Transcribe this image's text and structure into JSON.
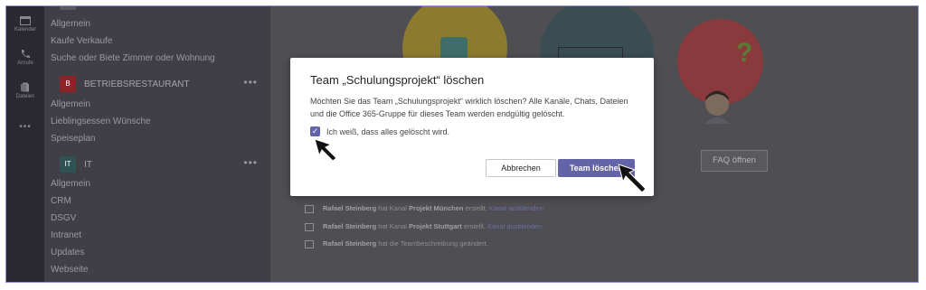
{
  "rail": {
    "items": [
      {
        "label": "Kalender",
        "icon": "calendar-icon"
      },
      {
        "label": "Anrufe",
        "icon": "phone-icon"
      },
      {
        "label": "Dateien",
        "icon": "files-icon"
      },
      {
        "label": "•••",
        "icon": "more-icon"
      }
    ]
  },
  "teams_panel": {
    "channels_top": [
      "Allgemein",
      "Kaufe Verkaufe",
      "Suche oder Biete Zimmer oder Wohnung"
    ],
    "team_betrieb": {
      "name": "BETRIEBSRESTAURANT",
      "badge": "B",
      "color": "#b4232a",
      "more": "•••"
    },
    "channels_betrieb": [
      "Allgemein",
      "Lieblingsessen Wünsche",
      "Speiseplan"
    ],
    "team_it": {
      "name": "IT",
      "badge": "IT",
      "color": "#2a6a6a",
      "more": "•••"
    },
    "channels_it": [
      "Allgemein",
      "CRM",
      "DSGV",
      "Intranet",
      "Updates",
      "Webseite"
    ]
  },
  "main": {
    "faq_button": "FAQ öffnen",
    "activity": [
      {
        "user": "Rafael Steinberg",
        "text1": " hat Kanal ",
        "channel": "Projekt München",
        "text2": " erstellt. ",
        "link": "Kanal ausblenden"
      },
      {
        "user": "Rafael Steinberg",
        "text1": " hat Kanal ",
        "channel": "Projekt Stuttgart",
        "text2": " erstellt. ",
        "link": "Kanal ausblenden"
      },
      {
        "user": "Rafael Steinberg",
        "text1": " hat die Teambeschreibung geändert.",
        "channel": "",
        "text2": "",
        "link": ""
      }
    ]
  },
  "dialog": {
    "title": "Team „Schulungsprojekt“ löschen",
    "message": "Möchten Sie das Team „Schulungsprojekt“ wirklich löschen? Alle Kanäle, Chats, Dateien und die Office 365-Gruppe für dieses Team werden endgültig gelöscht.",
    "checkbox_label": "Ich weiß, dass alles gelöscht wird.",
    "checkbox_checked": true,
    "cancel_label": "Abbrechen",
    "delete_label": "Team löschen"
  },
  "colors": {
    "accent": "#6264a7",
    "overlay": "#4f4e52",
    "rail": "#2a2931"
  }
}
